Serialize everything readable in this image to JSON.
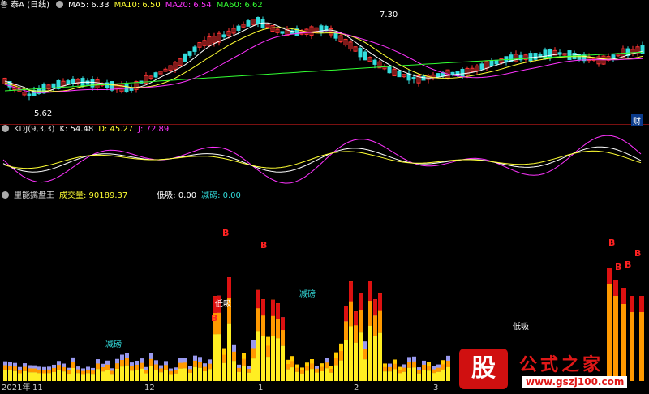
{
  "main": {
    "title": "鲁 泰A (日线)",
    "ma5": "MA5: 6.33",
    "ma10": "MA10: 6.50",
    "ma20": "MA20: 6.54",
    "ma60": "MA60: 6.62",
    "high_label": "7.30",
    "low_label": "5.62",
    "badge": "财",
    "colors": {
      "ma5": "#ffffff",
      "ma10": "#ffff33",
      "ma20": "#ff33ff",
      "ma60": "#33ff33",
      "up": "#ff3333",
      "down": "#33dddd"
    }
  },
  "kdj": {
    "title": "KDJ(9,3,3)",
    "k": "K: 54.48",
    "d": "D: 45.27",
    "j": "J: 72.89"
  },
  "ind": {
    "title": "里能擒盘王",
    "vol": "成交量: 90189.37",
    "dx": "低吸: 0.00",
    "jc": "减磅: 0.00",
    "labels": {
      "b": "B",
      "dx": "低吸",
      "jc": "减磅"
    }
  },
  "axis": {
    "year": "2021年",
    "m1": "11",
    "m2": "12",
    "m3": "1",
    "m4": "2",
    "m5": "3"
  },
  "watermark": {
    "logo": "股",
    "name": "公式之家",
    "url": "www.gszj100.com"
  }
}
